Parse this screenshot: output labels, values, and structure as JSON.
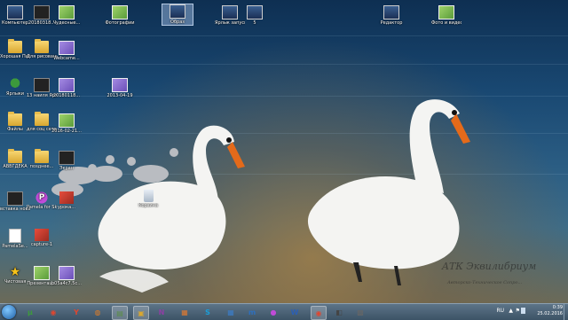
{
  "desktop": {
    "icons": [
      {
        "name": "computer-icon",
        "glyph": "screen",
        "label": "Компьютер"
      },
      {
        "name": "screenshot-icon",
        "glyph": "thumb-dark",
        "label": "20180318..."
      },
      {
        "name": "photo-icon",
        "glyph": "thumb-green",
        "label": "Чудесные..."
      },
      {
        "name": "picture-icon",
        "glyph": "thumb-green",
        "label": "Фотографии"
      },
      {
        "name": "selected-item-icon",
        "glyph": "screen",
        "label": "Образ",
        "selected": true
      },
      {
        "name": "app-shortcut-icon",
        "glyph": "screen",
        "label": "Ярлык запуск..."
      },
      {
        "name": "app-shortcut-2-icon",
        "glyph": "screen",
        "label": "5"
      },
      {
        "name": "tools-icon",
        "glyph": "screen",
        "label": "Редактор"
      },
      {
        "name": "video-icon",
        "glyph": "thumb-green",
        "label": "Фото и видео избранное"
      },
      {
        "name": "folder-icon",
        "glyph": "folder",
        "label": "Хорошая Папка"
      },
      {
        "name": "folder-2-icon",
        "glyph": "folder",
        "label": "Для рисования"
      },
      {
        "name": "webcam-icon",
        "glyph": "thumb-purple",
        "label": "Webcame..."
      },
      {
        "name": "tree-icon",
        "glyph": "tree",
        "label": "Ярлыки"
      },
      {
        "name": "screenshot-2-icon",
        "glyph": "thumb-dark",
        "label": "13 наиля Ярлыки"
      },
      {
        "name": "image-2-icon",
        "glyph": "thumb-purple",
        "label": "20180118..."
      },
      {
        "name": "image-dated-icon",
        "glyph": "thumb-purple",
        "label": "2013-04-19"
      },
      {
        "name": "folder-3-icon",
        "glyph": "folder",
        "label": "Файлы"
      },
      {
        "name": "folder-4-icon",
        "glyph": "folder",
        "label": "для соц сетей"
      },
      {
        "name": "image-3-icon",
        "glyph": "thumb-green",
        "label": "2016-02-21..."
      },
      {
        "name": "folder-5-icon",
        "glyph": "folder",
        "label": "АВВГДЕКА"
      },
      {
        "name": "folder-6-icon",
        "glyph": "folder",
        "label": "позднее..."
      },
      {
        "name": "screenshot-3-icon",
        "glyph": "thumb-dark",
        "label": "Экран"
      },
      {
        "name": "recycle-bin-icon",
        "glyph": "bin",
        "label": "Корзина"
      },
      {
        "name": "paste-icon",
        "glyph": "thumb-dark",
        "label": "вставка новая"
      },
      {
        "name": "pamela-icon",
        "glyph": "pink",
        "label": "Pamela for Skype"
      },
      {
        "name": "lessons-icon",
        "glyph": "thumb-red",
        "label": "урока..."
      },
      {
        "name": "pamela-settings-icon",
        "glyph": "doc",
        "label": "PamelaSe..."
      },
      {
        "name": "capture-icon",
        "glyph": "thumb-red",
        "label": "capture-1"
      },
      {
        "name": "star-icon",
        "glyph": "star",
        "label": "Чистовая"
      },
      {
        "name": "presentation-icon",
        "glyph": "thumb-green",
        "label": "Презентац..."
      },
      {
        "name": "image-4-icon",
        "glyph": "thumb-purple",
        "label": "b05a4c7.5c..."
      }
    ],
    "watermark": {
      "main": "AТК Эквилибриум",
      "sub": "Авторско-Техническое Сопро..."
    }
  },
  "taskbar": {
    "apps": [
      {
        "name": "utorrent-icon",
        "glyph": "μ",
        "color": "#3c9a3c"
      },
      {
        "name": "chrome-icon",
        "glyph": "◉",
        "color": "#e0462f"
      },
      {
        "name": "yandex-icon",
        "glyph": "Y",
        "color": "#e0462f"
      },
      {
        "name": "firefox-icon",
        "glyph": "◍",
        "color": "#e67e22"
      },
      {
        "name": "minimized-window-icon",
        "glyph": "▤",
        "color": "#5a8d47",
        "active": true
      },
      {
        "name": "explorer-icon",
        "glyph": "▣",
        "color": "#d9a730",
        "active": true
      },
      {
        "name": "onenote-icon",
        "glyph": "N",
        "color": "#8e3ea4"
      },
      {
        "name": "photo-app-icon",
        "glyph": "▦",
        "color": "#e07a2f"
      },
      {
        "name": "skype-icon",
        "glyph": "S",
        "color": "#1a9ed9"
      },
      {
        "name": "tiles-icon",
        "glyph": "▦",
        "color": "#3a7dc9"
      },
      {
        "name": "m-app-icon",
        "glyph": "m",
        "color": "#2d6fbd"
      },
      {
        "name": "pamela-taskbar-icon",
        "glyph": "●",
        "color": "#c04bd8"
      },
      {
        "name": "word-icon",
        "glyph": "W",
        "color": "#2b5fb4"
      },
      {
        "name": "chrome-2-icon",
        "glyph": "◉",
        "color": "#e0462f",
        "active": true
      },
      {
        "name": "recorder-icon",
        "glyph": "◧",
        "color": "#444"
      },
      {
        "name": "settings-app-icon",
        "glyph": "▩",
        "color": "#666"
      }
    ],
    "tray": {
      "lang": "RU",
      "chevron": "▲",
      "flag": "⚑",
      "time": "0:39",
      "date": "25.02.2016"
    }
  }
}
